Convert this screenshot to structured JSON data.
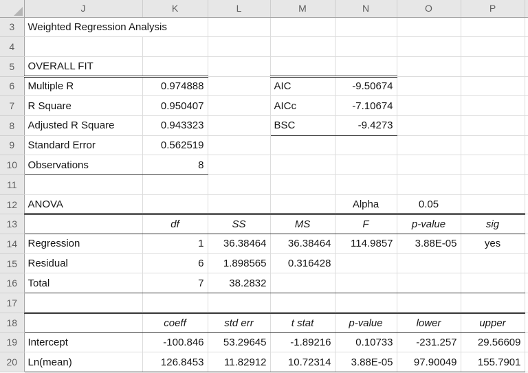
{
  "grid": {
    "columns": [
      "J",
      "K",
      "L",
      "M",
      "N",
      "O",
      "P"
    ],
    "rows": [
      "3",
      "4",
      "5",
      "6",
      "7",
      "8",
      "9",
      "10",
      "11",
      "12",
      "13",
      "14",
      "15",
      "16",
      "17",
      "18",
      "19",
      "20"
    ],
    "corner_icon": "select-all-triangle"
  },
  "title": "Weighted Regression Analysis",
  "overall_fit": {
    "header": "OVERALL FIT",
    "items": [
      {
        "label": "Multiple R",
        "value": "0.974888"
      },
      {
        "label": "R Square",
        "value": "0.950407"
      },
      {
        "label": "Adjusted R Square",
        "value": "0.943323"
      },
      {
        "label": "Standard Error",
        "value": "0.562519"
      },
      {
        "label": "Observations",
        "value": "8"
      }
    ]
  },
  "information_criteria": {
    "items": [
      {
        "label": "AIC",
        "value": "-9.50674"
      },
      {
        "label": "AICc",
        "value": "-7.10674"
      },
      {
        "label": "BSC",
        "value": "-9.4273"
      }
    ]
  },
  "anova": {
    "header": "ANOVA",
    "alpha_label": "Alpha",
    "alpha_value": "0.05",
    "columns": [
      "df",
      "SS",
      "MS",
      "F",
      "p-value",
      "sig"
    ],
    "rows": [
      {
        "label": "Regression",
        "df": "1",
        "ss": "36.38464",
        "ms": "36.38464",
        "f": "114.9857",
        "p_value": "3.88E-05",
        "sig": "yes"
      },
      {
        "label": "Residual",
        "df": "6",
        "ss": "1.898565",
        "ms": "0.316428",
        "f": "",
        "p_value": "",
        "sig": ""
      },
      {
        "label": "Total",
        "df": "7",
        "ss": "38.2832",
        "ms": "",
        "f": "",
        "p_value": "",
        "sig": ""
      }
    ]
  },
  "coefficients": {
    "columns": [
      "coeff",
      "std err",
      "t stat",
      "p-value",
      "lower",
      "upper"
    ],
    "rows": [
      {
        "label": "Intercept",
        "coeff": "-100.846",
        "std_err": "53.29645",
        "t_stat": "-1.89216",
        "p_value": "0.10733",
        "lower": "-231.257",
        "upper": "29.56609"
      },
      {
        "label": "Ln(mean)",
        "coeff": "126.8453",
        "std_err": "11.82912",
        "t_stat": "10.72314",
        "p_value": "3.88E-05",
        "lower": "97.90049",
        "upper": "155.7901"
      }
    ]
  },
  "colors": {
    "header_bg": "#e7e7e7",
    "header_text": "#5f5f5f",
    "gridline": "#dcdcdc",
    "table_border": "#333333",
    "cell_text": "#161616"
  }
}
